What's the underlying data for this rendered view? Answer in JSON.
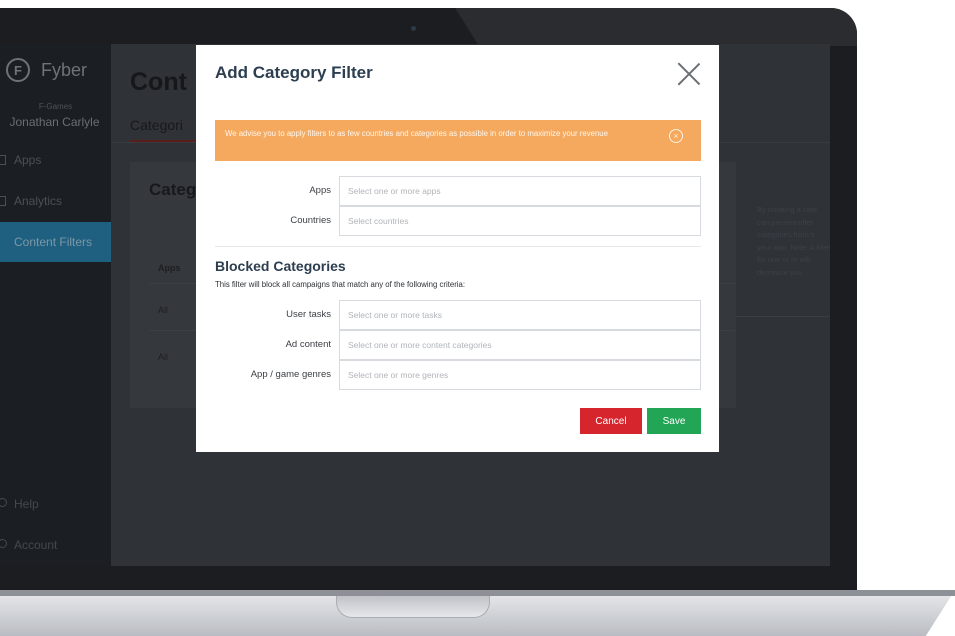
{
  "sidebar": {
    "brand": "Fyber",
    "org": "F-Games",
    "user": "Jonathan Carlyle",
    "items": [
      {
        "label": "Apps",
        "icon": "apps-icon"
      },
      {
        "label": "Analytics",
        "icon": "analytics-icon"
      },
      {
        "label": "Content Filters",
        "icon": "filter-icon",
        "active": true
      }
    ],
    "bottom": [
      {
        "label": "Help",
        "icon": "help-icon"
      },
      {
        "label": "Account",
        "icon": "account-icon"
      }
    ]
  },
  "main": {
    "title": "Cont",
    "tab": "Categori",
    "card_title": "Categ",
    "table": {
      "header": "Apps",
      "rows": [
        "All",
        "All"
      ]
    },
    "side_note": "By creating a cate can prevent offer categories from s your app. Note: A filter for one or m will decrease you"
  },
  "modal": {
    "title": "Add Category Filter",
    "alert": "We advise you to apply filters to as few countries and categories as possible in order to maximize your revenue",
    "fields": [
      {
        "label": "Apps",
        "placeholder": "Select one or more apps"
      },
      {
        "label": "Countries",
        "placeholder": "Select countries"
      }
    ],
    "blocked": {
      "title": "Blocked Categories",
      "subtitle": "This filter will block all campaigns that match any of the following criteria:",
      "fields": [
        {
          "label": "User tasks",
          "placeholder": "Select one or more tasks"
        },
        {
          "label": "Ad content",
          "placeholder": "Select one or more content categories"
        },
        {
          "label": "App / game genres",
          "placeholder": "Select one or more genres"
        }
      ]
    },
    "cancel_label": "Cancel",
    "save_label": "Save"
  },
  "colors": {
    "alert": "#f5a95e",
    "cancel": "#d6252c",
    "save": "#23a556",
    "title": "#2c3e50",
    "active_nav": "#1f5f80"
  }
}
